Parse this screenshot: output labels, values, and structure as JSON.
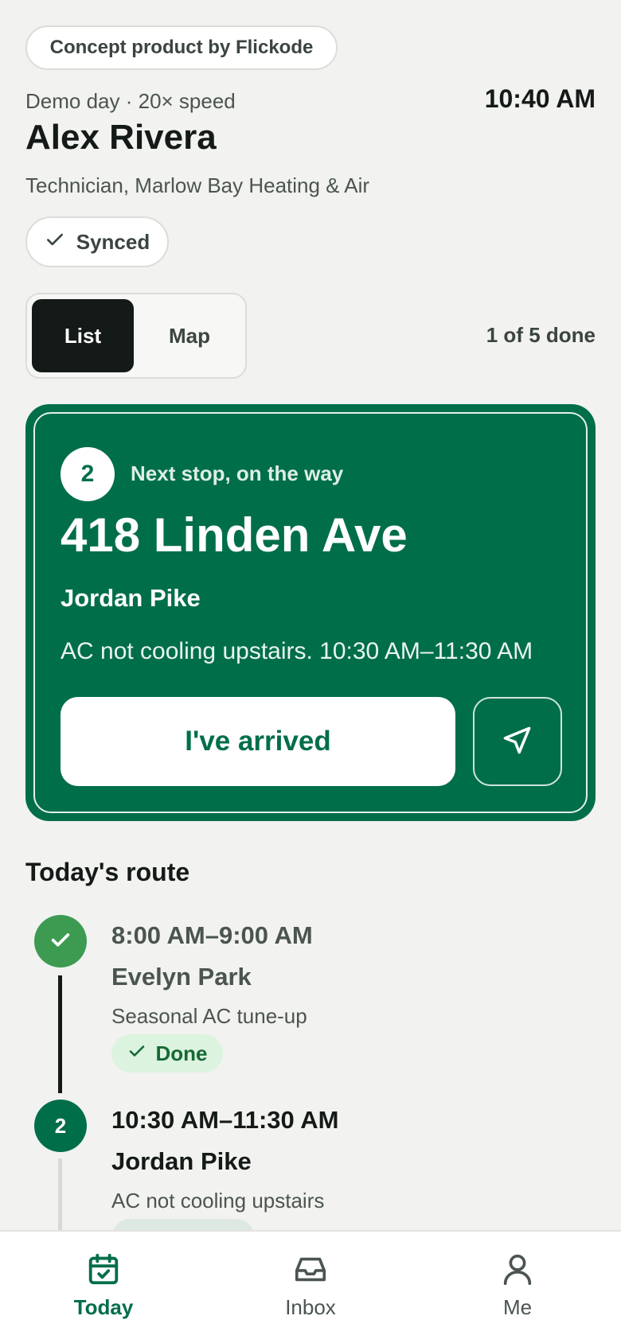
{
  "concept_badge": "Concept product by Flickode",
  "header": {
    "demo_line": "Demo day · 20× speed",
    "time": "10:40 AM",
    "technician_name": "Alex Rivera",
    "company": "Technician, Marlow Bay Heating & Air",
    "sync_status": "Synced"
  },
  "view_toggle": {
    "list_label": "List",
    "map_label": "Map",
    "active": "List"
  },
  "progress_text": "1 of 5 done",
  "next_stop": {
    "number": "2",
    "label": "Next stop, on the way",
    "address": "418 Linden Ave",
    "customer": "Jordan Pike",
    "description": "AC not cooling upstairs. 10:30 AM–11:30 AM",
    "arrived_button": "I've arrived",
    "navigate_icon": "navigation-arrow-icon"
  },
  "route": {
    "title": "Today's route",
    "stops": [
      {
        "status": "done",
        "time": "8:00 AM–9:00 AM",
        "customer": "Evelyn Park",
        "description": "Seasonal AC tune-up",
        "badge": "Done"
      },
      {
        "status": "current",
        "number": "2",
        "time": "10:30 AM–11:30 AM",
        "customer": "Jordan Pike",
        "description": "AC not cooling upstairs"
      }
    ]
  },
  "tabs": [
    {
      "label": "Today",
      "icon": "calendar-check-icon",
      "active": true
    },
    {
      "label": "Inbox",
      "icon": "inbox-icon",
      "active": false
    },
    {
      "label": "Me",
      "icon": "user-icon",
      "active": false
    }
  ],
  "colors": {
    "brand_green": "#016e4a",
    "done_green": "#3c9b50",
    "background": "#f2f2f0",
    "ink": "#141a17"
  }
}
